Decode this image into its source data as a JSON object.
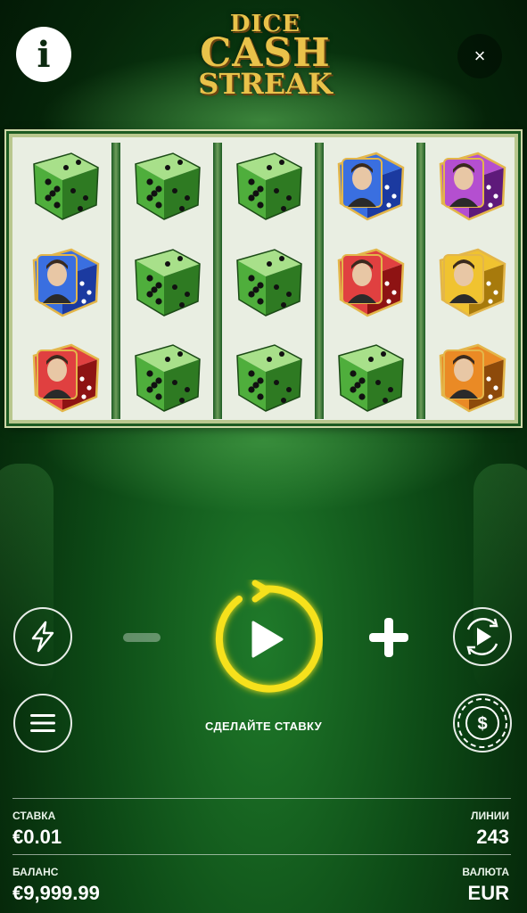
{
  "game": {
    "logo_line1": "DICE",
    "logo_line2": "CASH",
    "logo_line3": "STREAK"
  },
  "header": {
    "info_icon": "info-icon",
    "info_glyph": "i",
    "close_icon": "close-icon",
    "close_glyph": "×"
  },
  "reels": [
    [
      "dice-green-5",
      "portrait-lincoln-blue",
      "portrait-washington-red"
    ],
    [
      "dice-green-5",
      "dice-green-5",
      "dice-green-5"
    ],
    [
      "dice-green-5",
      "dice-green-5",
      "dice-green-5"
    ],
    [
      "portrait-lincoln-blue",
      "portrait-washington-red",
      "dice-green-5"
    ],
    [
      "portrait-franklin-purple",
      "portrait-jackson-yellow",
      "portrait-grant-orange"
    ]
  ],
  "controls": {
    "turbo_icon": "lightning-icon",
    "menu_icon": "hamburger-menu-icon",
    "autoplay_icon": "autoplay-icon",
    "bet_icon": "dollar-chip-icon",
    "spin_icon": "spin-play-icon",
    "spin_hint": "СДЕЛАЙТЕ СТАВКУ"
  },
  "footer": {
    "bet_label": "СТАВКА",
    "bet_value": "€0.01",
    "lines_label": "ЛИНИИ",
    "lines_value": "243",
    "balance_label": "БАЛАНС",
    "balance_value": "€9,999.99",
    "currency_label": "ВАЛЮТА",
    "currency_value": "EUR"
  },
  "colors": {
    "felt": "#0d4a16",
    "gold": "#e9c24a",
    "spin_glow": "#f6e11a"
  }
}
